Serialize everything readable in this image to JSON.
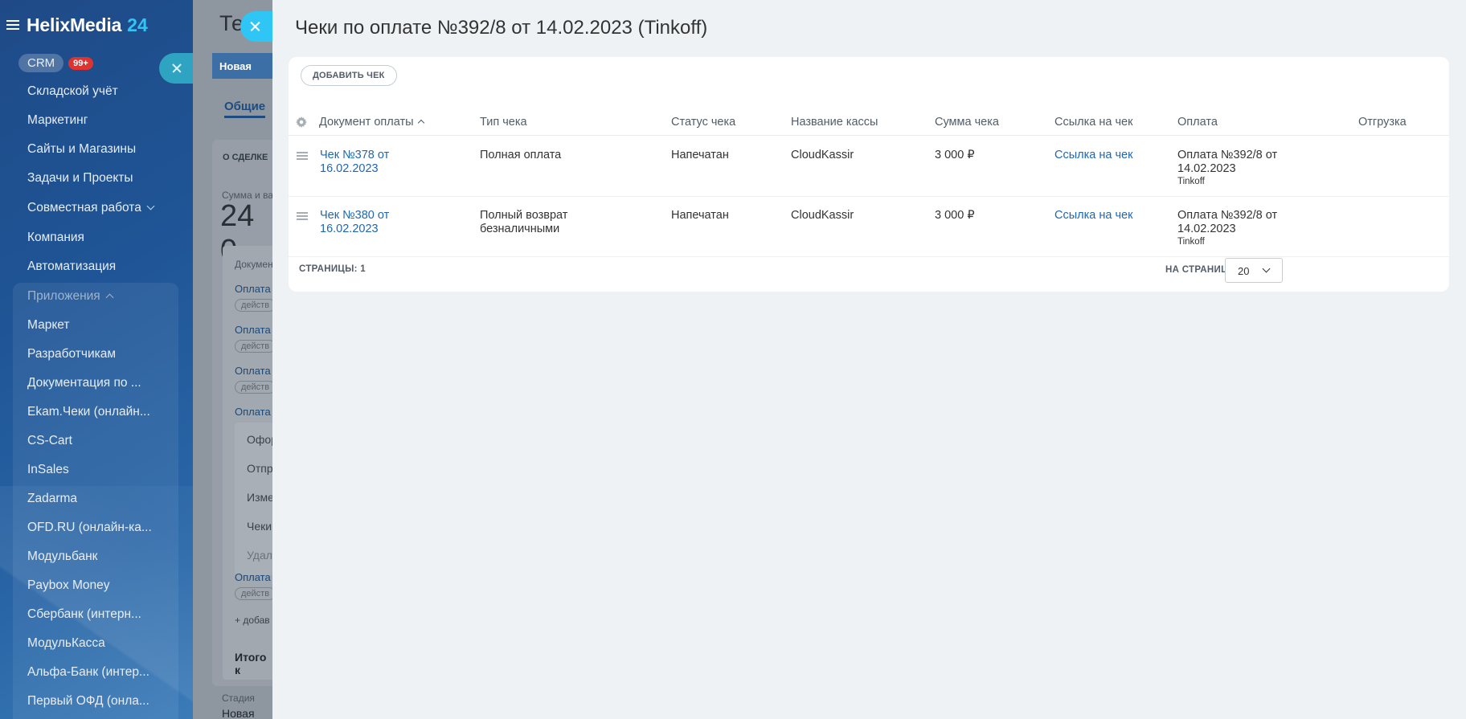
{
  "sidebar": {
    "logo_text": "HelixMedia",
    "logo_num": "24",
    "crm_label": "CRM",
    "crm_badge": "99+",
    "items": [
      "Складской учёт",
      "Маркетинг",
      "Сайты и Магазины",
      "Задачи и Проекты",
      "Совместная работа",
      "Компания",
      "Автоматизация"
    ],
    "apps_label": "Приложения",
    "apps": [
      "Маркет",
      "Разработчикам",
      "Документация по ...",
      "Ekam.Чеки (онлайн...",
      "CS-Cart",
      "InSales",
      "Zadarma",
      "OFD.RU (онлайн-ка...",
      "Модульбанк",
      "Paybox Money",
      "Сбербанк (интерн...",
      "МодульКасса",
      "Альфа-Банк (интер...",
      "Первый ОФД (онла..."
    ]
  },
  "background": {
    "title": "Те",
    "stage": "Новая",
    "tab": "Общие",
    "section": "О СДЕЛКЕ",
    "sum_label": "Сумма и ва",
    "sum": "24 0",
    "docs_label": "Докумен",
    "link": "Оплата",
    "tag": "действ",
    "menu": [
      "Офор",
      "Отпр",
      "Изме",
      "Чеки",
      "Удал"
    ],
    "add": "+ добав",
    "total": "Итого к",
    "stage_label": "Стадия",
    "stage_value": "Новая"
  },
  "panel": {
    "title": "Чеки по оплате №392/8 от 14.02.2023 (Tinkoff)",
    "add_button": "ДОБАВИТЬ ЧЕК",
    "columns": [
      "Документ оплаты",
      "Тип чека",
      "Статус чека",
      "Название кассы",
      "Сумма чека",
      "Ссылка на чек",
      "Оплата",
      "Отгрузка"
    ],
    "rows": [
      {
        "doc": "Чек №378 от 16.02.2023",
        "type": "Полная оплата",
        "status": "Напечатан",
        "cashbox": "CloudKassir",
        "sum": "3 000 ₽",
        "link": "Ссылка на чек",
        "payment": "Оплата №392/8 от 14.02.2023",
        "payment_system": "Tinkoff",
        "shipment": ""
      },
      {
        "doc": "Чек №380 от 16.02.2023",
        "type": "Полный возврат безналичными",
        "status": "Напечатан",
        "cashbox": "CloudKassir",
        "sum": "3 000 ₽",
        "link": "Ссылка на чек",
        "payment": "Оплата №392/8 от 14.02.2023",
        "payment_system": "Tinkoff",
        "shipment": ""
      }
    ],
    "pages_label": "СТРАНИЦЫ: 1",
    "per_page_label": "НА СТРАНИЦЕ:",
    "per_page_value": "20"
  },
  "icons": {
    "close": "close-icon",
    "settings": "gear-icon",
    "drag": "drag-handle-icon",
    "sort": "sort-asc-icon",
    "dropdown": "chevron-down-icon",
    "menu": "hamburger-icon"
  },
  "colors": {
    "accent": "#2fc6f6",
    "link": "#2067b0",
    "badge": "#e0322f"
  }
}
